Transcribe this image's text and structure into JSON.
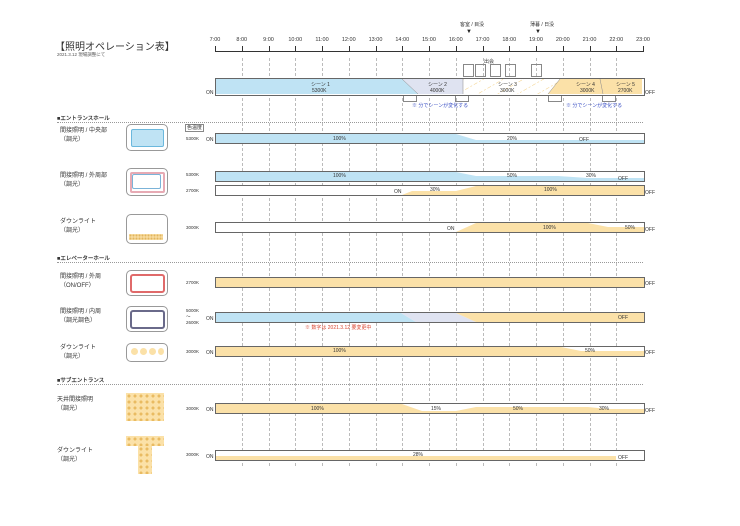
{
  "header": {
    "title": "【照明オペレーション表】",
    "subtitle": "2021.3.12 現場調整にて"
  },
  "markers": [
    {
      "label": "客室 / 目没",
      "time": "16:30"
    },
    {
      "label": "薄暮 / 日没",
      "time": "19:15"
    }
  ],
  "times": [
    "7:00",
    "8:00",
    "9:00",
    "10:00",
    "11:00",
    "12:00",
    "13:00",
    "14:00",
    "15:00",
    "16:00",
    "17:00",
    "18:00",
    "19:00",
    "20:00",
    "21:00",
    "22:00",
    "23:00"
  ],
  "scene_bar": {
    "on": "ON",
    "off": "OFF",
    "scenes": [
      {
        "name": "シーン 1",
        "kelvin": "5300K"
      },
      {
        "name": "シーン 2",
        "kelvin": "4000K"
      },
      {
        "name": "シーン 3",
        "kelvin": "3000K"
      },
      {
        "name": "シーン 4",
        "kelvin": "3000K"
      },
      {
        "name": "シーン 5",
        "kelvin": "2700K"
      }
    ],
    "note1": "※ 分でシーンが変化する",
    "note2": "※ 分でシーンが変化する",
    "small_label": "出会"
  },
  "color_temp_header": "色温度",
  "sections": [
    {
      "title": "■エントランスホール"
    },
    {
      "title": "■エレベーターホール"
    },
    {
      "title": "■サブエントランス"
    }
  ],
  "rows": [
    {
      "label": "間接照明 / 中央部\n（調光）",
      "kelvin": "5300K",
      "on": "ON",
      "off": "OFF",
      "values": [
        "100%",
        "20%"
      ]
    },
    {
      "label": "間接照明 / 外周部\n（調光）",
      "kelvin": "5300K",
      "kelvin2": "2700K",
      "on": "ON",
      "off": "OFF",
      "values": [
        "100%",
        "50%",
        "30%"
      ],
      "values2": [
        "ON",
        "30%",
        "100%"
      ]
    },
    {
      "label": "ダウンライト\n（調光）",
      "kelvin": "3000K",
      "on": "ON",
      "off": "OFF",
      "values": [
        "100%",
        "50%"
      ]
    },
    {
      "label": "間接照明 / 外周\n（ON/OFF）",
      "kelvin": "2700K",
      "off": "OFF"
    },
    {
      "label": "間接照明 / 内周\n（調光調色）",
      "kelvin": "5000K\n〜\n2600K",
      "on": "ON",
      "off": "OFF",
      "note": "※ 数字は 2021.3.12 要変更中"
    },
    {
      "label": "ダウンライト\n（調光）",
      "kelvin": "3000K",
      "on": "ON",
      "off": "OFF",
      "values": [
        "100%",
        "50%"
      ]
    },
    {
      "label": "天井間接照明\n（調光）",
      "kelvin": "3000K",
      "on": "ON",
      "off": "OFF",
      "values": [
        "100%",
        "15%",
        "50%",
        "30%"
      ]
    },
    {
      "label": "ダウンライト\n（調光）",
      "kelvin": "3000K",
      "on": "ON",
      "off": "OFF",
      "values": [
        "28%"
      ]
    }
  ],
  "colors": {
    "blue": "#bfe3f4",
    "orange": "#fbe1a8",
    "lav": "#dfe3f1"
  }
}
